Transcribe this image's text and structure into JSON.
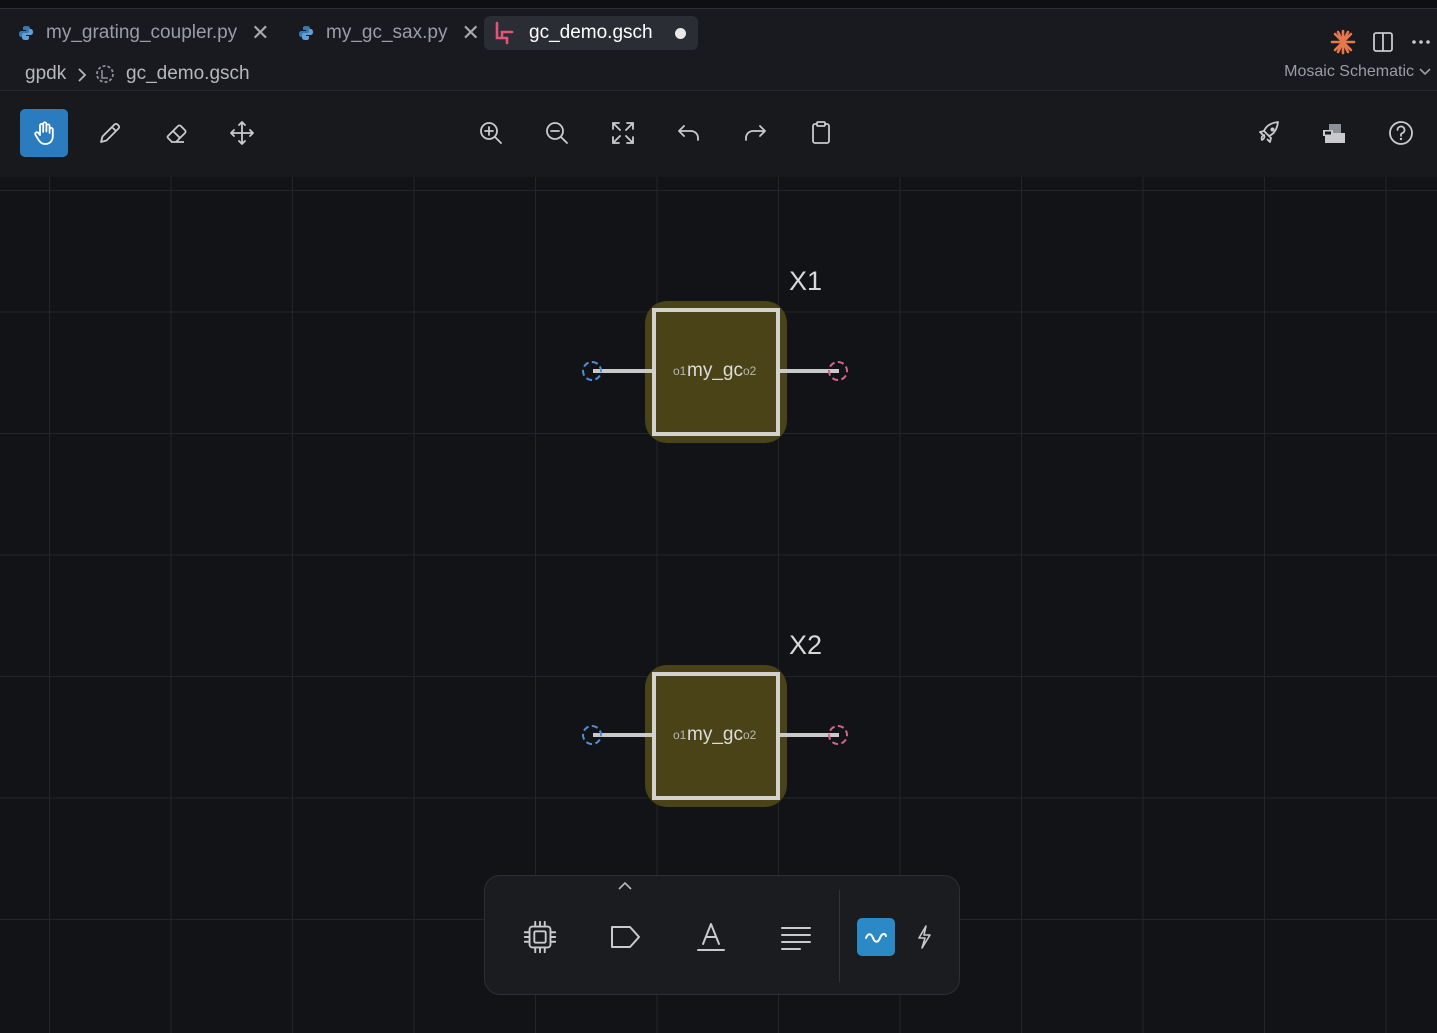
{
  "tabs": [
    {
      "label": "my_grating_coupler.py",
      "icon": "python-icon"
    },
    {
      "label": "my_gc_sax.py",
      "icon": "python-icon"
    },
    {
      "label": "gc_demo.gsch",
      "icon": "schematic-icon",
      "active": true,
      "modified": true
    }
  ],
  "breadcrumb": {
    "root": "gpdk",
    "file": "gc_demo.gsch"
  },
  "editor_mode": "Mosaic Schematic",
  "toolbar": {
    "left": [
      "pan-hand-icon",
      "pencil-icon",
      "eraser-icon",
      "move-icon"
    ],
    "center": [
      "zoom-in-icon",
      "zoom-out-icon",
      "fit-view-icon",
      "undo-icon",
      "redo-icon",
      "clipboard-icon"
    ],
    "right": [
      "rocket-icon",
      "netlist-icon",
      "help-icon"
    ]
  },
  "instances": [
    {
      "name": "X1",
      "cell": "my_gc",
      "port_in": "o1",
      "port_out": "o2"
    },
    {
      "name": "X2",
      "cell": "my_gc",
      "port_in": "o1",
      "port_out": "o2"
    }
  ],
  "palette": [
    "chip-icon",
    "label-tag-icon",
    "text-icon",
    "align-icon",
    "waveguide-icon",
    "electrical-icon"
  ],
  "colors": {
    "accent": "#2b7bbf",
    "component_fill": "#4a4318",
    "port_in": "#4c8ed8",
    "port_out": "#d6628a"
  }
}
